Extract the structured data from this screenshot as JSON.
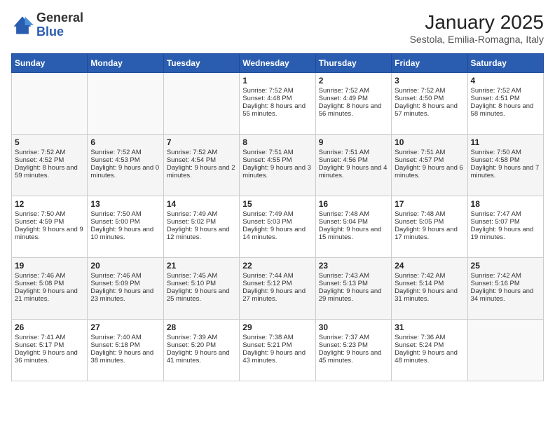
{
  "header": {
    "logo_general": "General",
    "logo_blue": "Blue",
    "title": "January 2025",
    "subtitle": "Sestola, Emilia-Romagna, Italy"
  },
  "days_of_week": [
    "Sunday",
    "Monday",
    "Tuesday",
    "Wednesday",
    "Thursday",
    "Friday",
    "Saturday"
  ],
  "weeks": [
    [
      {
        "day": "",
        "info": ""
      },
      {
        "day": "",
        "info": ""
      },
      {
        "day": "",
        "info": ""
      },
      {
        "day": "1",
        "info": "Sunrise: 7:52 AM\nSunset: 4:48 PM\nDaylight: 8 hours and 55 minutes."
      },
      {
        "day": "2",
        "info": "Sunrise: 7:52 AM\nSunset: 4:49 PM\nDaylight: 8 hours and 56 minutes."
      },
      {
        "day": "3",
        "info": "Sunrise: 7:52 AM\nSunset: 4:50 PM\nDaylight: 8 hours and 57 minutes."
      },
      {
        "day": "4",
        "info": "Sunrise: 7:52 AM\nSunset: 4:51 PM\nDaylight: 8 hours and 58 minutes."
      }
    ],
    [
      {
        "day": "5",
        "info": "Sunrise: 7:52 AM\nSunset: 4:52 PM\nDaylight: 8 hours and 59 minutes."
      },
      {
        "day": "6",
        "info": "Sunrise: 7:52 AM\nSunset: 4:53 PM\nDaylight: 9 hours and 0 minutes."
      },
      {
        "day": "7",
        "info": "Sunrise: 7:52 AM\nSunset: 4:54 PM\nDaylight: 9 hours and 2 minutes."
      },
      {
        "day": "8",
        "info": "Sunrise: 7:51 AM\nSunset: 4:55 PM\nDaylight: 9 hours and 3 minutes."
      },
      {
        "day": "9",
        "info": "Sunrise: 7:51 AM\nSunset: 4:56 PM\nDaylight: 9 hours and 4 minutes."
      },
      {
        "day": "10",
        "info": "Sunrise: 7:51 AM\nSunset: 4:57 PM\nDaylight: 9 hours and 6 minutes."
      },
      {
        "day": "11",
        "info": "Sunrise: 7:50 AM\nSunset: 4:58 PM\nDaylight: 9 hours and 7 minutes."
      }
    ],
    [
      {
        "day": "12",
        "info": "Sunrise: 7:50 AM\nSunset: 4:59 PM\nDaylight: 9 hours and 9 minutes."
      },
      {
        "day": "13",
        "info": "Sunrise: 7:50 AM\nSunset: 5:00 PM\nDaylight: 9 hours and 10 minutes."
      },
      {
        "day": "14",
        "info": "Sunrise: 7:49 AM\nSunset: 5:02 PM\nDaylight: 9 hours and 12 minutes."
      },
      {
        "day": "15",
        "info": "Sunrise: 7:49 AM\nSunset: 5:03 PM\nDaylight: 9 hours and 14 minutes."
      },
      {
        "day": "16",
        "info": "Sunrise: 7:48 AM\nSunset: 5:04 PM\nDaylight: 9 hours and 15 minutes."
      },
      {
        "day": "17",
        "info": "Sunrise: 7:48 AM\nSunset: 5:05 PM\nDaylight: 9 hours and 17 minutes."
      },
      {
        "day": "18",
        "info": "Sunrise: 7:47 AM\nSunset: 5:07 PM\nDaylight: 9 hours and 19 minutes."
      }
    ],
    [
      {
        "day": "19",
        "info": "Sunrise: 7:46 AM\nSunset: 5:08 PM\nDaylight: 9 hours and 21 minutes."
      },
      {
        "day": "20",
        "info": "Sunrise: 7:46 AM\nSunset: 5:09 PM\nDaylight: 9 hours and 23 minutes."
      },
      {
        "day": "21",
        "info": "Sunrise: 7:45 AM\nSunset: 5:10 PM\nDaylight: 9 hours and 25 minutes."
      },
      {
        "day": "22",
        "info": "Sunrise: 7:44 AM\nSunset: 5:12 PM\nDaylight: 9 hours and 27 minutes."
      },
      {
        "day": "23",
        "info": "Sunrise: 7:43 AM\nSunset: 5:13 PM\nDaylight: 9 hours and 29 minutes."
      },
      {
        "day": "24",
        "info": "Sunrise: 7:42 AM\nSunset: 5:14 PM\nDaylight: 9 hours and 31 minutes."
      },
      {
        "day": "25",
        "info": "Sunrise: 7:42 AM\nSunset: 5:16 PM\nDaylight: 9 hours and 34 minutes."
      }
    ],
    [
      {
        "day": "26",
        "info": "Sunrise: 7:41 AM\nSunset: 5:17 PM\nDaylight: 9 hours and 36 minutes."
      },
      {
        "day": "27",
        "info": "Sunrise: 7:40 AM\nSunset: 5:18 PM\nDaylight: 9 hours and 38 minutes."
      },
      {
        "day": "28",
        "info": "Sunrise: 7:39 AM\nSunset: 5:20 PM\nDaylight: 9 hours and 41 minutes."
      },
      {
        "day": "29",
        "info": "Sunrise: 7:38 AM\nSunset: 5:21 PM\nDaylight: 9 hours and 43 minutes."
      },
      {
        "day": "30",
        "info": "Sunrise: 7:37 AM\nSunset: 5:23 PM\nDaylight: 9 hours and 45 minutes."
      },
      {
        "day": "31",
        "info": "Sunrise: 7:36 AM\nSunset: 5:24 PM\nDaylight: 9 hours and 48 minutes."
      },
      {
        "day": "",
        "info": ""
      }
    ]
  ]
}
